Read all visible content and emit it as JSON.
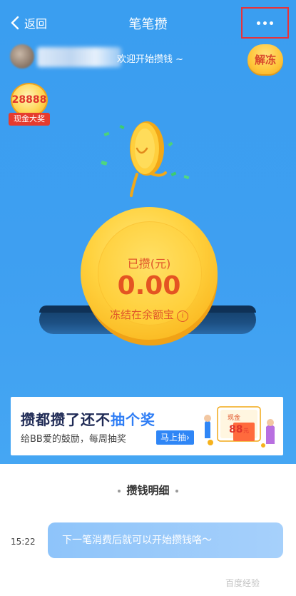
{
  "nav": {
    "back_label": "返回",
    "title": "笔笔攒",
    "more_icon": "more-icon"
  },
  "header": {
    "welcome_text": "欢迎开始攒钱 ~",
    "unfreeze_label": "解冻"
  },
  "prize": {
    "amount": "28888",
    "tag": "现金大奖"
  },
  "coin": {
    "label": "已攒(元)",
    "amount": "0.00",
    "freeze_text": "冻结在余额宝",
    "info_icon": "info-icon"
  },
  "banner": {
    "title_prefix": "攒都攒了还不",
    "title_highlight": "抽个奖",
    "subtitle": "给BB爱的鼓励，每周抽奖",
    "button_label": "马上抽",
    "button_arrow": "›",
    "badge": "88",
    "badge_unit": "元",
    "badge_top": "现金"
  },
  "details": {
    "title": "攒钱明细",
    "items": [
      {
        "time": "15:22",
        "message": "下一笔消费后就可以开始攒钱咯～"
      }
    ]
  },
  "watermark": "百度经验",
  "colors": {
    "hero_blue": "#3e9ff1",
    "coin_gold": "#ffd23f",
    "coin_text": "#e45422",
    "highlight": "#e8323a",
    "bubble": "#9ccafa"
  }
}
